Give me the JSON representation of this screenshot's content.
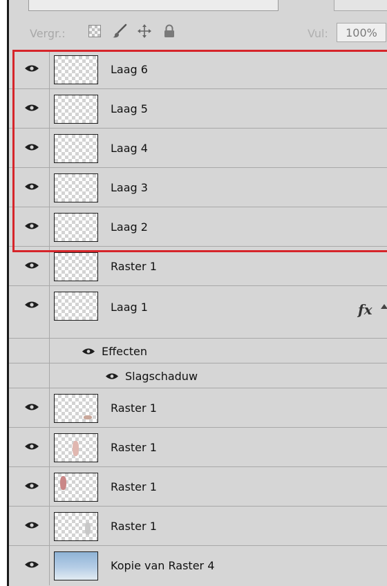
{
  "lock_bar": {
    "label": "Vergr.:",
    "fill_label": "Vul:",
    "fill_value": "100%",
    "icons": [
      "transparency-lock-icon",
      "brush-lock-icon",
      "move-lock-icon",
      "padlock-icon"
    ]
  },
  "layers": [
    {
      "name": "Laag 6"
    },
    {
      "name": "Laag 5"
    },
    {
      "name": "Laag 4"
    },
    {
      "name": "Laag 3"
    },
    {
      "name": "Laag 2"
    },
    {
      "name": "Raster 1"
    },
    {
      "name": "Laag 1",
      "fx": "fx"
    },
    {
      "name": "Raster 1"
    },
    {
      "name": "Raster 1"
    },
    {
      "name": "Raster 1"
    },
    {
      "name": "Raster 1"
    },
    {
      "name": "Kopie van Raster 4"
    }
  ],
  "effects": {
    "group_label": "Effecten",
    "items": [
      {
        "name": "Slagschaduw"
      }
    ]
  },
  "colors": {
    "panel_bg": "#d6d6d6",
    "highlight_border": "#d6252a"
  }
}
